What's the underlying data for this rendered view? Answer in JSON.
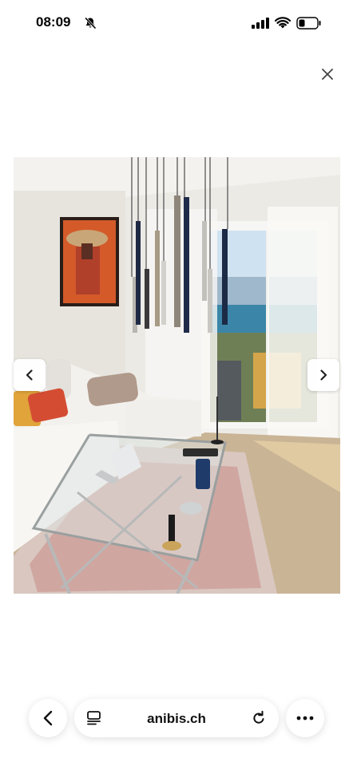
{
  "status_bar": {
    "time": "08:09",
    "icons": [
      "bell-slash-icon",
      "signal-bars-icon",
      "wifi-icon",
      "battery-icon"
    ]
  },
  "viewer": {
    "close_icon": "close-icon",
    "prev_icon": "chevron-left-icon",
    "next_icon": "chevron-right-icon"
  },
  "toolbar": {
    "url": "anibis.ch",
    "back_icon": "chevron-left-icon",
    "reader_icon": "reader-mode-icon",
    "reload_icon": "reload-icon",
    "more_icon": "more-dots-icon"
  },
  "colors": {
    "accent_text": "#000000",
    "toolbar_bg": "#ffffff"
  }
}
